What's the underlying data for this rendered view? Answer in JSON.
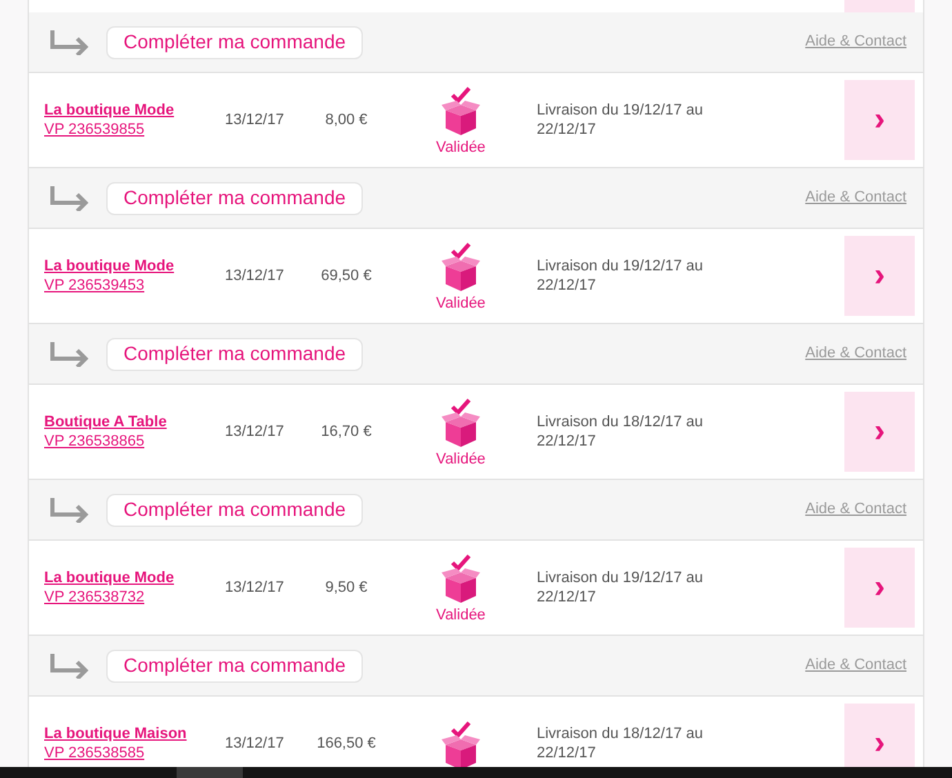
{
  "sections": [
    {
      "kind": "action",
      "button": "Compléter ma commande",
      "link": "Aide & Contact"
    },
    {
      "kind": "order",
      "shop": "La boutique Mode",
      "ref": "VP 236539855",
      "date": "13/12/17",
      "price": "8,00 €",
      "status": "Validée",
      "delivery": "Livraison du 19/12/17 au 22/12/17",
      "chevron": "›"
    },
    {
      "kind": "action",
      "button": "Compléter ma commande",
      "link": "Aide & Contact"
    },
    {
      "kind": "order",
      "shop": "La boutique Mode",
      "ref": "VP 236539453",
      "date": "13/12/17",
      "price": "69,50 €",
      "status": "Validée",
      "delivery": "Livraison du 19/12/17 au 22/12/17",
      "chevron": "›"
    },
    {
      "kind": "action",
      "button": "Compléter ma commande",
      "link": "Aide & Contact"
    },
    {
      "kind": "order",
      "shop": "Boutique A Table",
      "ref": "VP 236538865",
      "date": "13/12/17",
      "price": "16,70 €",
      "status": "Validée",
      "delivery": "Livraison du 18/12/17 au 22/12/17",
      "chevron": "›"
    },
    {
      "kind": "action",
      "button": "Compléter ma commande",
      "link": "Aide & Contact"
    },
    {
      "kind": "order",
      "shop": "La boutique Mode",
      "ref": "VP 236538732",
      "date": "13/12/17",
      "price": "9,50 €",
      "status": "Validée",
      "delivery": "Livraison du 19/12/17 au 22/12/17",
      "chevron": "›"
    },
    {
      "kind": "action",
      "button": "Compléter ma commande",
      "link": "Aide & Contact"
    },
    {
      "kind": "order",
      "shop": "La boutique Maison",
      "ref": "VP 236538585",
      "date": "13/12/17",
      "price": "166,50 €",
      "delivery": "Livraison du 18/12/17 au 22/12/17",
      "chevron": "›"
    }
  ]
}
